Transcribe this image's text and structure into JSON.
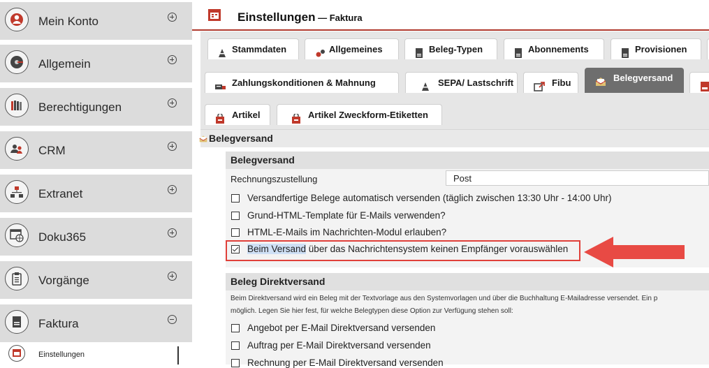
{
  "sidebar": {
    "items": [
      {
        "label": "Mein Konto",
        "icon": "user-icon",
        "toggle": "plus"
      },
      {
        "label": "Allgemein",
        "icon": "disc-icon",
        "toggle": "plus"
      },
      {
        "label": "Berechtigungen",
        "icon": "books-icon",
        "toggle": "plus"
      },
      {
        "label": "CRM",
        "icon": "people-icon",
        "toggle": "plus"
      },
      {
        "label": "Extranet",
        "icon": "network-icon",
        "toggle": "plus"
      },
      {
        "label": "Doku365",
        "icon": "globe-window-icon",
        "toggle": "plus"
      },
      {
        "label": "Vorgänge",
        "icon": "clipboard-icon",
        "toggle": "plus"
      },
      {
        "label": "Faktura",
        "icon": "invoice-icon",
        "toggle": "minus"
      }
    ],
    "sub_item": {
      "label": "Einstellungen",
      "icon": "calendar-icon"
    }
  },
  "header": {
    "title": "Einstellungen",
    "separator": " — ",
    "subtitle": "Faktura",
    "icon": "calendar-icon"
  },
  "tabs_row1": [
    "Stammdaten",
    "Allgemeines",
    "Beleg-Typen",
    "Abonnements",
    "Provisionen"
  ],
  "tabs_row2": [
    "Zahlungskonditionen & Mahnung",
    "SEPA/ Lastschrift",
    "Fibu",
    "Belegversand"
  ],
  "tabs_row3": [
    "Artikel",
    "Artikel Zweckform-Etiketten"
  ],
  "active_tab": "Belegversand",
  "section": {
    "title": "Belegversand"
  },
  "panel1": {
    "title": "Belegversand",
    "rechnungszustellung_label": "Rechnungszustellung",
    "rechnungszustellung_value": "Post",
    "options": [
      {
        "text": "Versandfertige Belege automatisch versenden (täglich zwischen 13:30 Uhr - 14:00 Uhr)",
        "checked": false
      },
      {
        "text": "Grund-HTML-Template für E-Mails verwenden?",
        "checked": false
      },
      {
        "text": "HTML-E-Mails im Nachrichten-Modul erlauben?",
        "checked": false
      },
      {
        "text_highlighted": "Beim Versand",
        "text_rest": " über das Nachrichtensystem keinen Empfänger vorauswählen",
        "checked": true
      }
    ]
  },
  "panel2": {
    "title": "Beleg Direktversand",
    "desc_line1": "Beim Direktversand wird ein Beleg mit der Textvorlage aus den Systemvorlagen und über die Buchhaltung E-Mailadresse versendet. Ein p",
    "desc_line2": "möglich. Legen Sie hier fest, für welche Belegtypen diese Option zur Verfügung stehen soll:",
    "options": [
      {
        "text": "Angebot per E-Mail Direktversand versenden",
        "checked": false
      },
      {
        "text": "Auftrag per E-Mail Direktversand versenden",
        "checked": false
      },
      {
        "text": "Rechnung per E-Mail Direktversand versenden",
        "checked": false
      }
    ]
  },
  "colors": {
    "accent_red": "#e0403a",
    "active_tab": "#6e6e6e",
    "header_line": "#b03a2e"
  }
}
